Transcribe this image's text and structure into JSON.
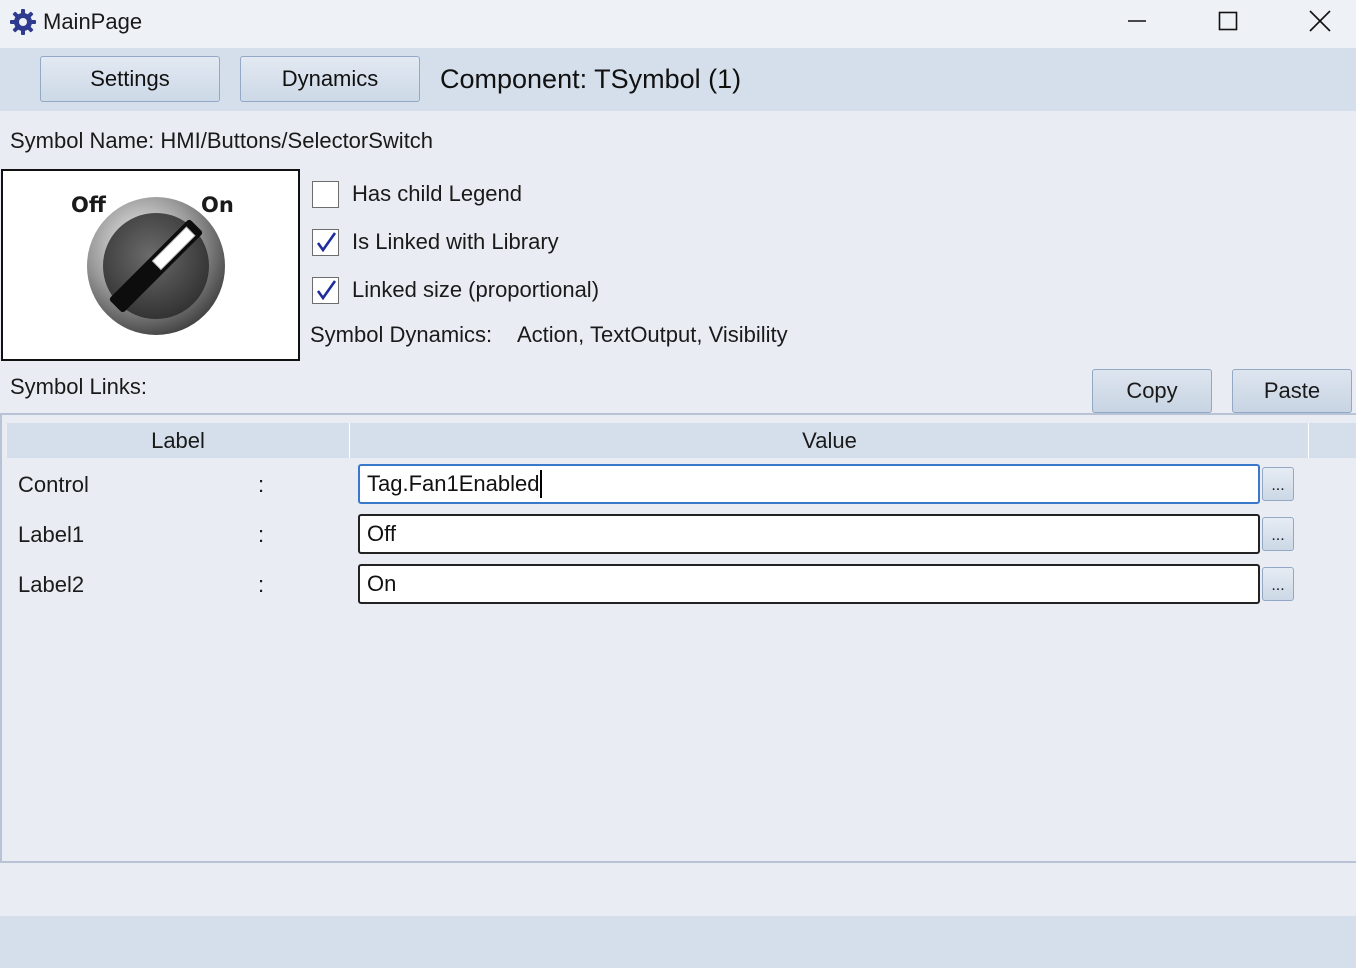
{
  "window": {
    "title": "MainPage",
    "icon": "gear-icon"
  },
  "toolbar": {
    "settings_label": "Settings",
    "dynamics_label": "Dynamics",
    "component_title": "Component: TSymbol (1)"
  },
  "symbol": {
    "name_text": "Symbol Name: HMI/Buttons/SelectorSwitch",
    "preview": {
      "off_label": "Off",
      "on_label": "On"
    }
  },
  "options": {
    "has_child_legend": {
      "label": "Has child Legend",
      "checked": false
    },
    "linked_with_library": {
      "label": "Is Linked with Library",
      "checked": true
    },
    "linked_size": {
      "label": "Linked size (proportional)",
      "checked": true
    }
  },
  "dynamics": {
    "label": "Symbol Dynamics:",
    "value": "Action, TextOutput, Visibility"
  },
  "links": {
    "label": "Symbol Links:",
    "copy_label": "Copy",
    "paste_label": "Paste",
    "columns": {
      "label": "Label",
      "value": "Value"
    },
    "rows": [
      {
        "name": "Control",
        "colon": ":",
        "value": "Tag.Fan1Enabled",
        "browse": "..."
      },
      {
        "name": "Label1",
        "colon": ":",
        "value": "Off",
        "browse": "..."
      },
      {
        "name": "Label2",
        "colon": ":",
        "value": "On",
        "browse": "..."
      }
    ]
  },
  "colors": {
    "toolbar_bg": "#d5dfeb",
    "window_bg": "#e9edf3",
    "focus_border": "#3a78c9",
    "check_mark": "#1f2c9c"
  }
}
